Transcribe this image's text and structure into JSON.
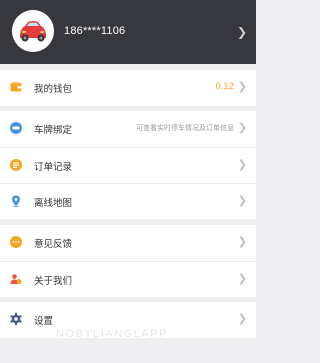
{
  "colors": {
    "header_bg": "#36383d",
    "accent_value": "#f5a623",
    "page_bg": "#efeff1",
    "icon_wallet": "#f5a623",
    "icon_plate": "#4a90e2",
    "icon_orders": "#f5a623",
    "icon_map": "#4a90e2",
    "icon_feedback": "#f5a623",
    "icon_about": "#e9573f",
    "icon_settings": "#4a5a7a"
  },
  "header": {
    "avatar": "car-avatar-icon",
    "phone": "186****1106"
  },
  "wallet": {
    "label": "我的钱包",
    "balance": "0.12",
    "icon": "wallet-icon"
  },
  "plate": {
    "label": "车牌绑定",
    "hint": "可查看实时停车情况及订单信息",
    "icon": "car-plate-icon"
  },
  "orders": {
    "label": "订单记录",
    "icon": "orders-icon"
  },
  "map": {
    "label": "离线地图",
    "icon": "map-pin-icon"
  },
  "feedback": {
    "label": "意见反馈",
    "icon": "feedback-icon"
  },
  "about": {
    "label": "关于我们",
    "icon": "about-icon"
  },
  "settings": {
    "label": "设置",
    "icon": "gear-icon"
  },
  "watermark": "NOBYLIANGLAPP"
}
